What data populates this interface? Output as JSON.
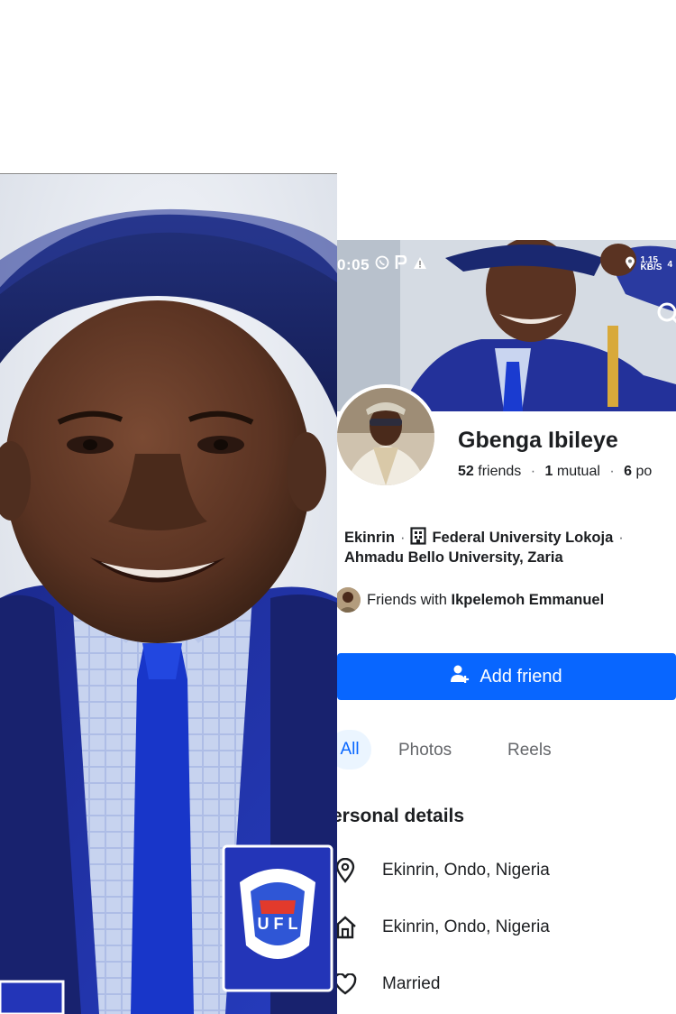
{
  "status_bar": {
    "time": "0:05",
    "speed_top": "1.15",
    "speed_bottom": "KB/S",
    "battery_partial": "4"
  },
  "profile": {
    "name": "Gbenga Ibileye",
    "friends_count": "52",
    "friends_label": "friends",
    "mutual_count": "1",
    "mutual_label": "mutual",
    "posts_count": "6",
    "posts_label": "po",
    "location_short": "Ekinrin",
    "workplace": "Federal University Lokoja",
    "education": "Ahmadu Bello University, Zaria",
    "mutual_friend_prefix": "Friends with",
    "mutual_friend_name": "Ikpelemoh Emmanuel"
  },
  "actions": {
    "add_friend": "Add friend"
  },
  "tabs": [
    {
      "label": "All"
    },
    {
      "label": "Photos"
    },
    {
      "label": "Reels"
    }
  ],
  "personal_details": {
    "title": "ersonal details",
    "items": [
      {
        "icon": "location-pin-icon",
        "text": "Ekinrin, Ondo, Nigeria"
      },
      {
        "icon": "home-icon",
        "text": "Ekinrin, Ondo, Nigeria"
      },
      {
        "icon": "heart-icon",
        "text": "Married"
      }
    ]
  },
  "colors": {
    "accent": "#0866ff",
    "text": "#1c1e21",
    "muted": "#65676b",
    "gown": "#1f2a8a",
    "cap": "#1b2a6b"
  }
}
